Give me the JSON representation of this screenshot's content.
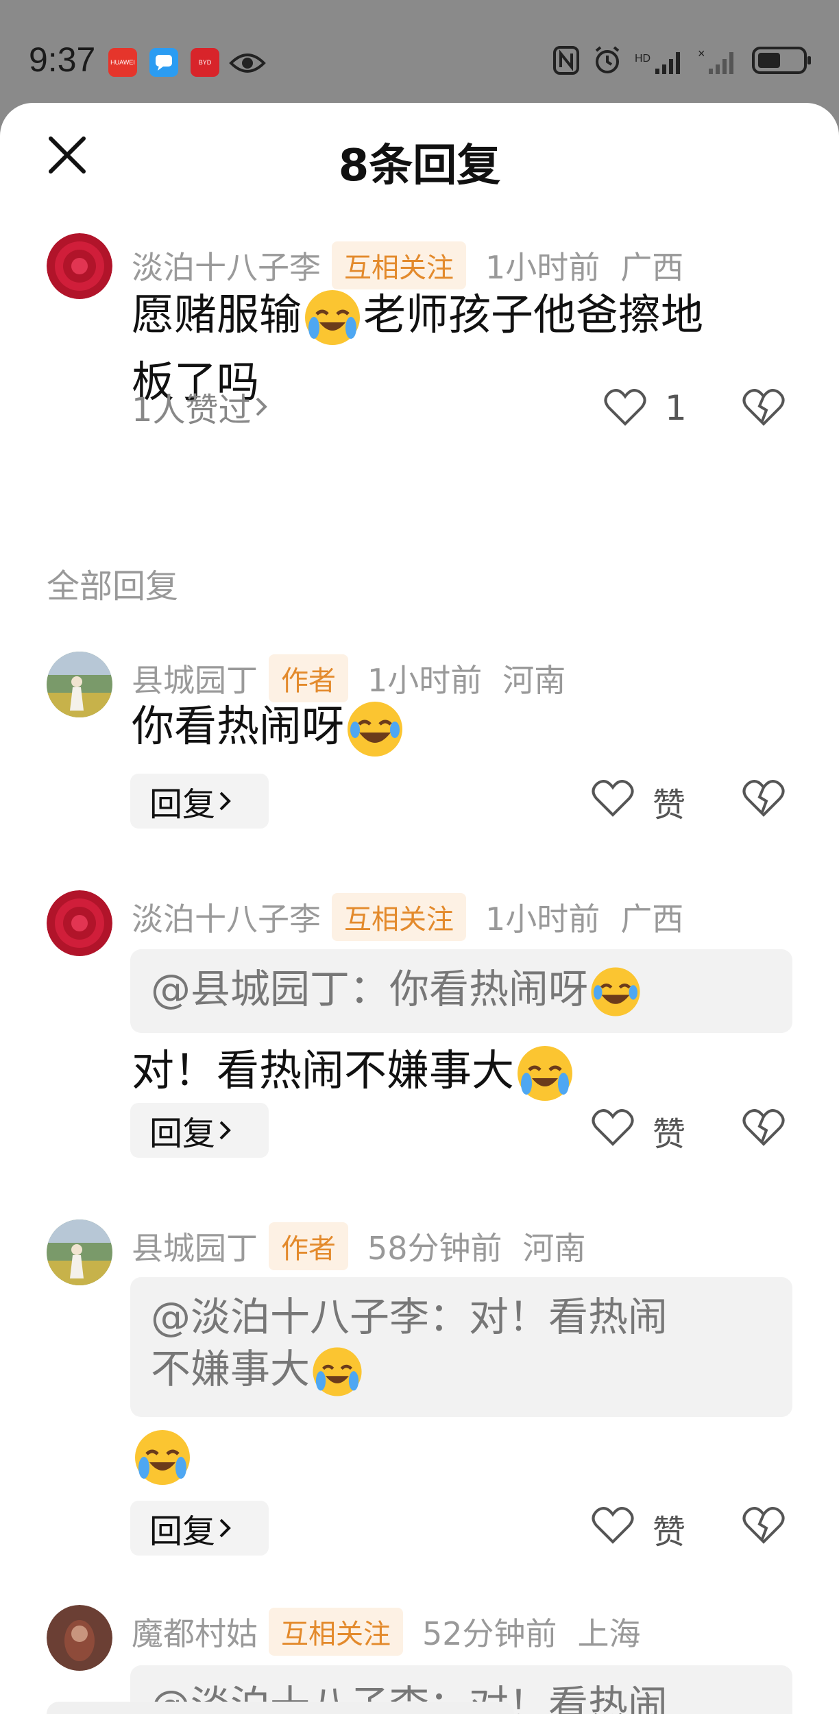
{
  "status_bar": {
    "time": "9:37",
    "apps": [
      {
        "name": "HUAWEI",
        "color": "#e5352b"
      },
      {
        "name": "",
        "color": "#2b9cf2"
      },
      {
        "name": "BYD",
        "color": "#d8242a"
      }
    ],
    "right_icons": [
      "nfc-icon",
      "alarm-icon",
      "signal-icon",
      "signal-no-sim-icon",
      "battery-icon"
    ]
  },
  "sheet": {
    "title": "8条回复"
  },
  "main_comment": {
    "author": "淡泊十八子李",
    "tag": "互相关注",
    "time": "1小时前",
    "location": "广西",
    "text_line1": "愿赌服输",
    "text_line1b": "老师孩子他爸擦地",
    "text_line2": "板了吗",
    "liked_by": "1人赞过",
    "like_count": "1"
  },
  "section_label": "全部回复",
  "replies": [
    {
      "author": "县城园丁",
      "tag": "作者",
      "time": "1小时前",
      "location": "河南",
      "text": "你看热闹呀",
      "reply_label": "回复",
      "like_label": "赞"
    },
    {
      "author": "淡泊十八子李",
      "tag": "互相关注",
      "time": "1小时前",
      "location": "广西",
      "quote": "@县城园丁：你看热闹呀",
      "text": "对！看热闹不嫌事大",
      "reply_label": "回复",
      "like_label": "赞"
    },
    {
      "author": "县城园丁",
      "tag": "作者",
      "time": "58分钟前",
      "location": "河南",
      "quote_line1": "@淡泊十八子李：对！看热闹",
      "quote_line2": "不嫌事大",
      "reply_label": "回复",
      "like_label": "赞"
    },
    {
      "author": "魔都村姑",
      "tag": "互相关注",
      "time": "52分钟前",
      "location": "上海",
      "quote": "@淡泊十八子李：对！看热闹"
    }
  ],
  "colors": {
    "tag_bg": "#fdf1e4",
    "tag_text": "#e38a2c",
    "muted": "#999999"
  }
}
